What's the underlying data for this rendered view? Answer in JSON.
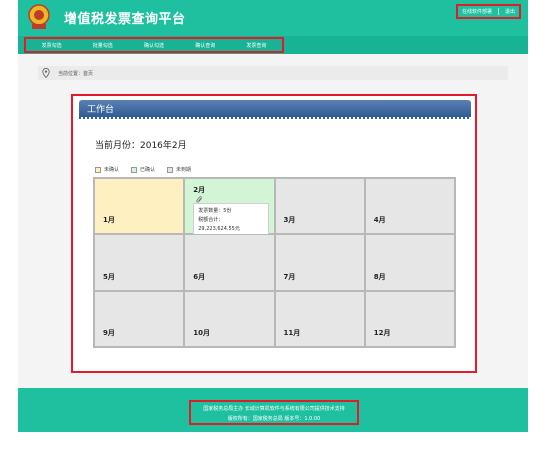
{
  "header": {
    "title": "增值税发票查询平台",
    "links": [
      "在线软件部署",
      "退出"
    ]
  },
  "nav": {
    "items": [
      "发票勾选",
      "批量勾选",
      "确认勾选",
      "确认查询",
      "发票查询"
    ]
  },
  "breadcrumb": {
    "text": "当前位置：首页"
  },
  "panel": {
    "title": "工作台",
    "current_month": "当前月份：2016年2月"
  },
  "legend": [
    {
      "label": "未确认",
      "color": "#fff0c2"
    },
    {
      "label": "已确认",
      "color": "#d2f5d6"
    },
    {
      "label": "未到期",
      "color": "#e6e6e6"
    }
  ],
  "calendar": {
    "months": [
      "1月",
      "2月",
      "3月",
      "4月",
      "5月",
      "6月",
      "7月",
      "8月",
      "9月",
      "10月",
      "11月",
      "12月"
    ],
    "invoice_count": "发票数量：5份",
    "tax_total": "税额合计：",
    "tax_amount": "29,223,624.55元"
  },
  "footer": {
    "line1": "国家税务总局主办 长城计算机软件与系统有限公司提供技术支持",
    "line2": "版权所有：国家税务总局 版本号：1.0.00"
  },
  "colors": {
    "header": "#1ec0a0",
    "nav": "#17b394",
    "panel_bar": "#2f5d95",
    "highlight": "#e21b2a"
  }
}
